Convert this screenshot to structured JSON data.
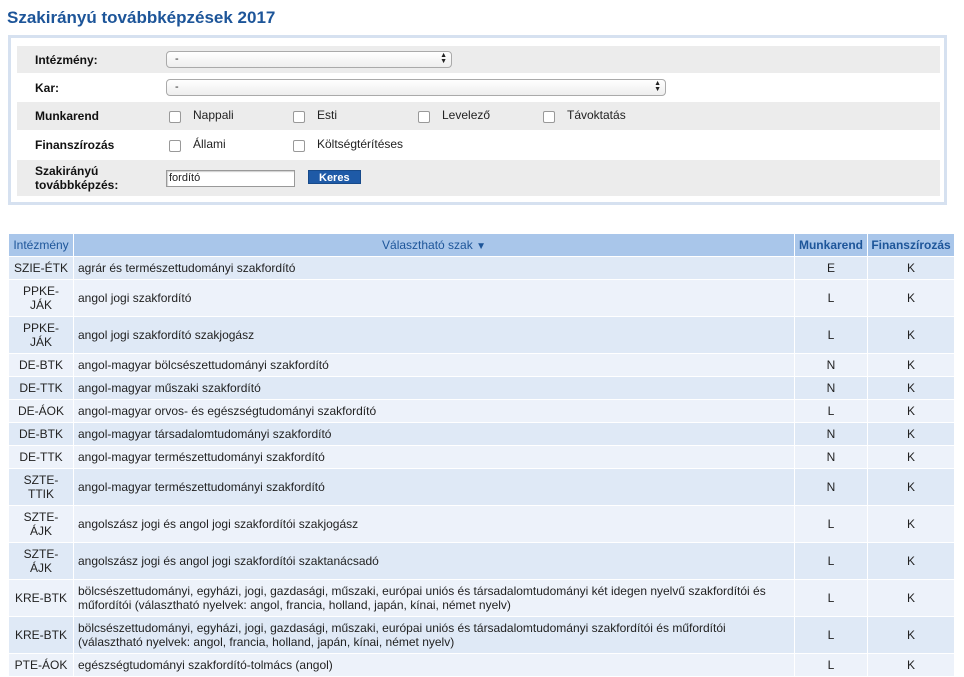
{
  "title": "Szakirányú továbbképzések 2017",
  "filters": {
    "institution": {
      "label": "Intézmény:",
      "value": "-"
    },
    "faculty": {
      "label": "Kar:",
      "value": "-"
    },
    "work_schedule": {
      "label": "Munkarend",
      "options": [
        "Nappali",
        "Esti",
        "Levelező",
        "Távoktatás"
      ]
    },
    "financing": {
      "label": "Finanszírozás",
      "options": [
        "Állami",
        "Költségtérítéses"
      ]
    },
    "course": {
      "label_line1": "Szakirányú",
      "label_line2": "továbbképzés:",
      "value": "fordító"
    },
    "search_label": "Keres"
  },
  "table": {
    "headers": {
      "institution": "Intézmény",
      "course": "Választható szak",
      "sort_indicator": "▼",
      "schedule": "Munkarend",
      "financing": "Finanszírozás"
    },
    "rows": [
      {
        "inst": "SZIE-ÉTK",
        "course": "agrár és természettudományi szakfordító",
        "mr": "E",
        "fin": "K"
      },
      {
        "inst": "PPKE-\nJÁK",
        "course": "angol jogi szakfordító",
        "mr": "L",
        "fin": "K"
      },
      {
        "inst": "PPKE-\nJÁK",
        "course": "angol jogi szakfordító szakjogász",
        "mr": "L",
        "fin": "K"
      },
      {
        "inst": "DE-BTK",
        "course": "angol-magyar bölcsészettudományi szakfordító",
        "mr": "N",
        "fin": "K"
      },
      {
        "inst": "DE-TTK",
        "course": "angol-magyar műszaki szakfordító",
        "mr": "N",
        "fin": "K"
      },
      {
        "inst": "DE-ÁOK",
        "course": "angol-magyar orvos- és egészségtudományi szakfordító",
        "mr": "L",
        "fin": "K"
      },
      {
        "inst": "DE-BTK",
        "course": "angol-magyar társadalomtudományi szakfordító",
        "mr": "N",
        "fin": "K"
      },
      {
        "inst": "DE-TTK",
        "course": "angol-magyar természettudományi szakfordító",
        "mr": "N",
        "fin": "K"
      },
      {
        "inst": "SZTE-\nTTIK",
        "course": "angol-magyar természettudományi szakfordító",
        "mr": "N",
        "fin": "K"
      },
      {
        "inst": "SZTE-\nÁJK",
        "course": "angolszász jogi és angol jogi szakfordítói szakjogász",
        "mr": "L",
        "fin": "K"
      },
      {
        "inst": "SZTE-\nÁJK",
        "course": "angolszász jogi és angol jogi szakfordítói szaktanácsadó",
        "mr": "L",
        "fin": "K"
      },
      {
        "inst": "KRE-BTK",
        "course": "bölcsészettudományi, egyházi, jogi, gazdasági, műszaki, európai uniós és társadalomtudományi két idegen nyelvű szakfordítói és\nműfordítói (választható nyelvek: angol, francia, holland, japán, kínai, német nyelv)",
        "mr": "L",
        "fin": "K"
      },
      {
        "inst": "KRE-BTK",
        "course": "bölcsészettudományi, egyházi, jogi, gazdasági, műszaki, európai uniós és társadalomtudományi szakfordítói és műfordítói\n(választható nyelvek: angol, francia, holland, japán, kínai, német nyelv)",
        "mr": "L",
        "fin": "K"
      },
      {
        "inst": "PTE-ÁOK",
        "course": "egészségtudományi szakfordító-tolmács (angol)",
        "mr": "L",
        "fin": "K"
      }
    ]
  }
}
